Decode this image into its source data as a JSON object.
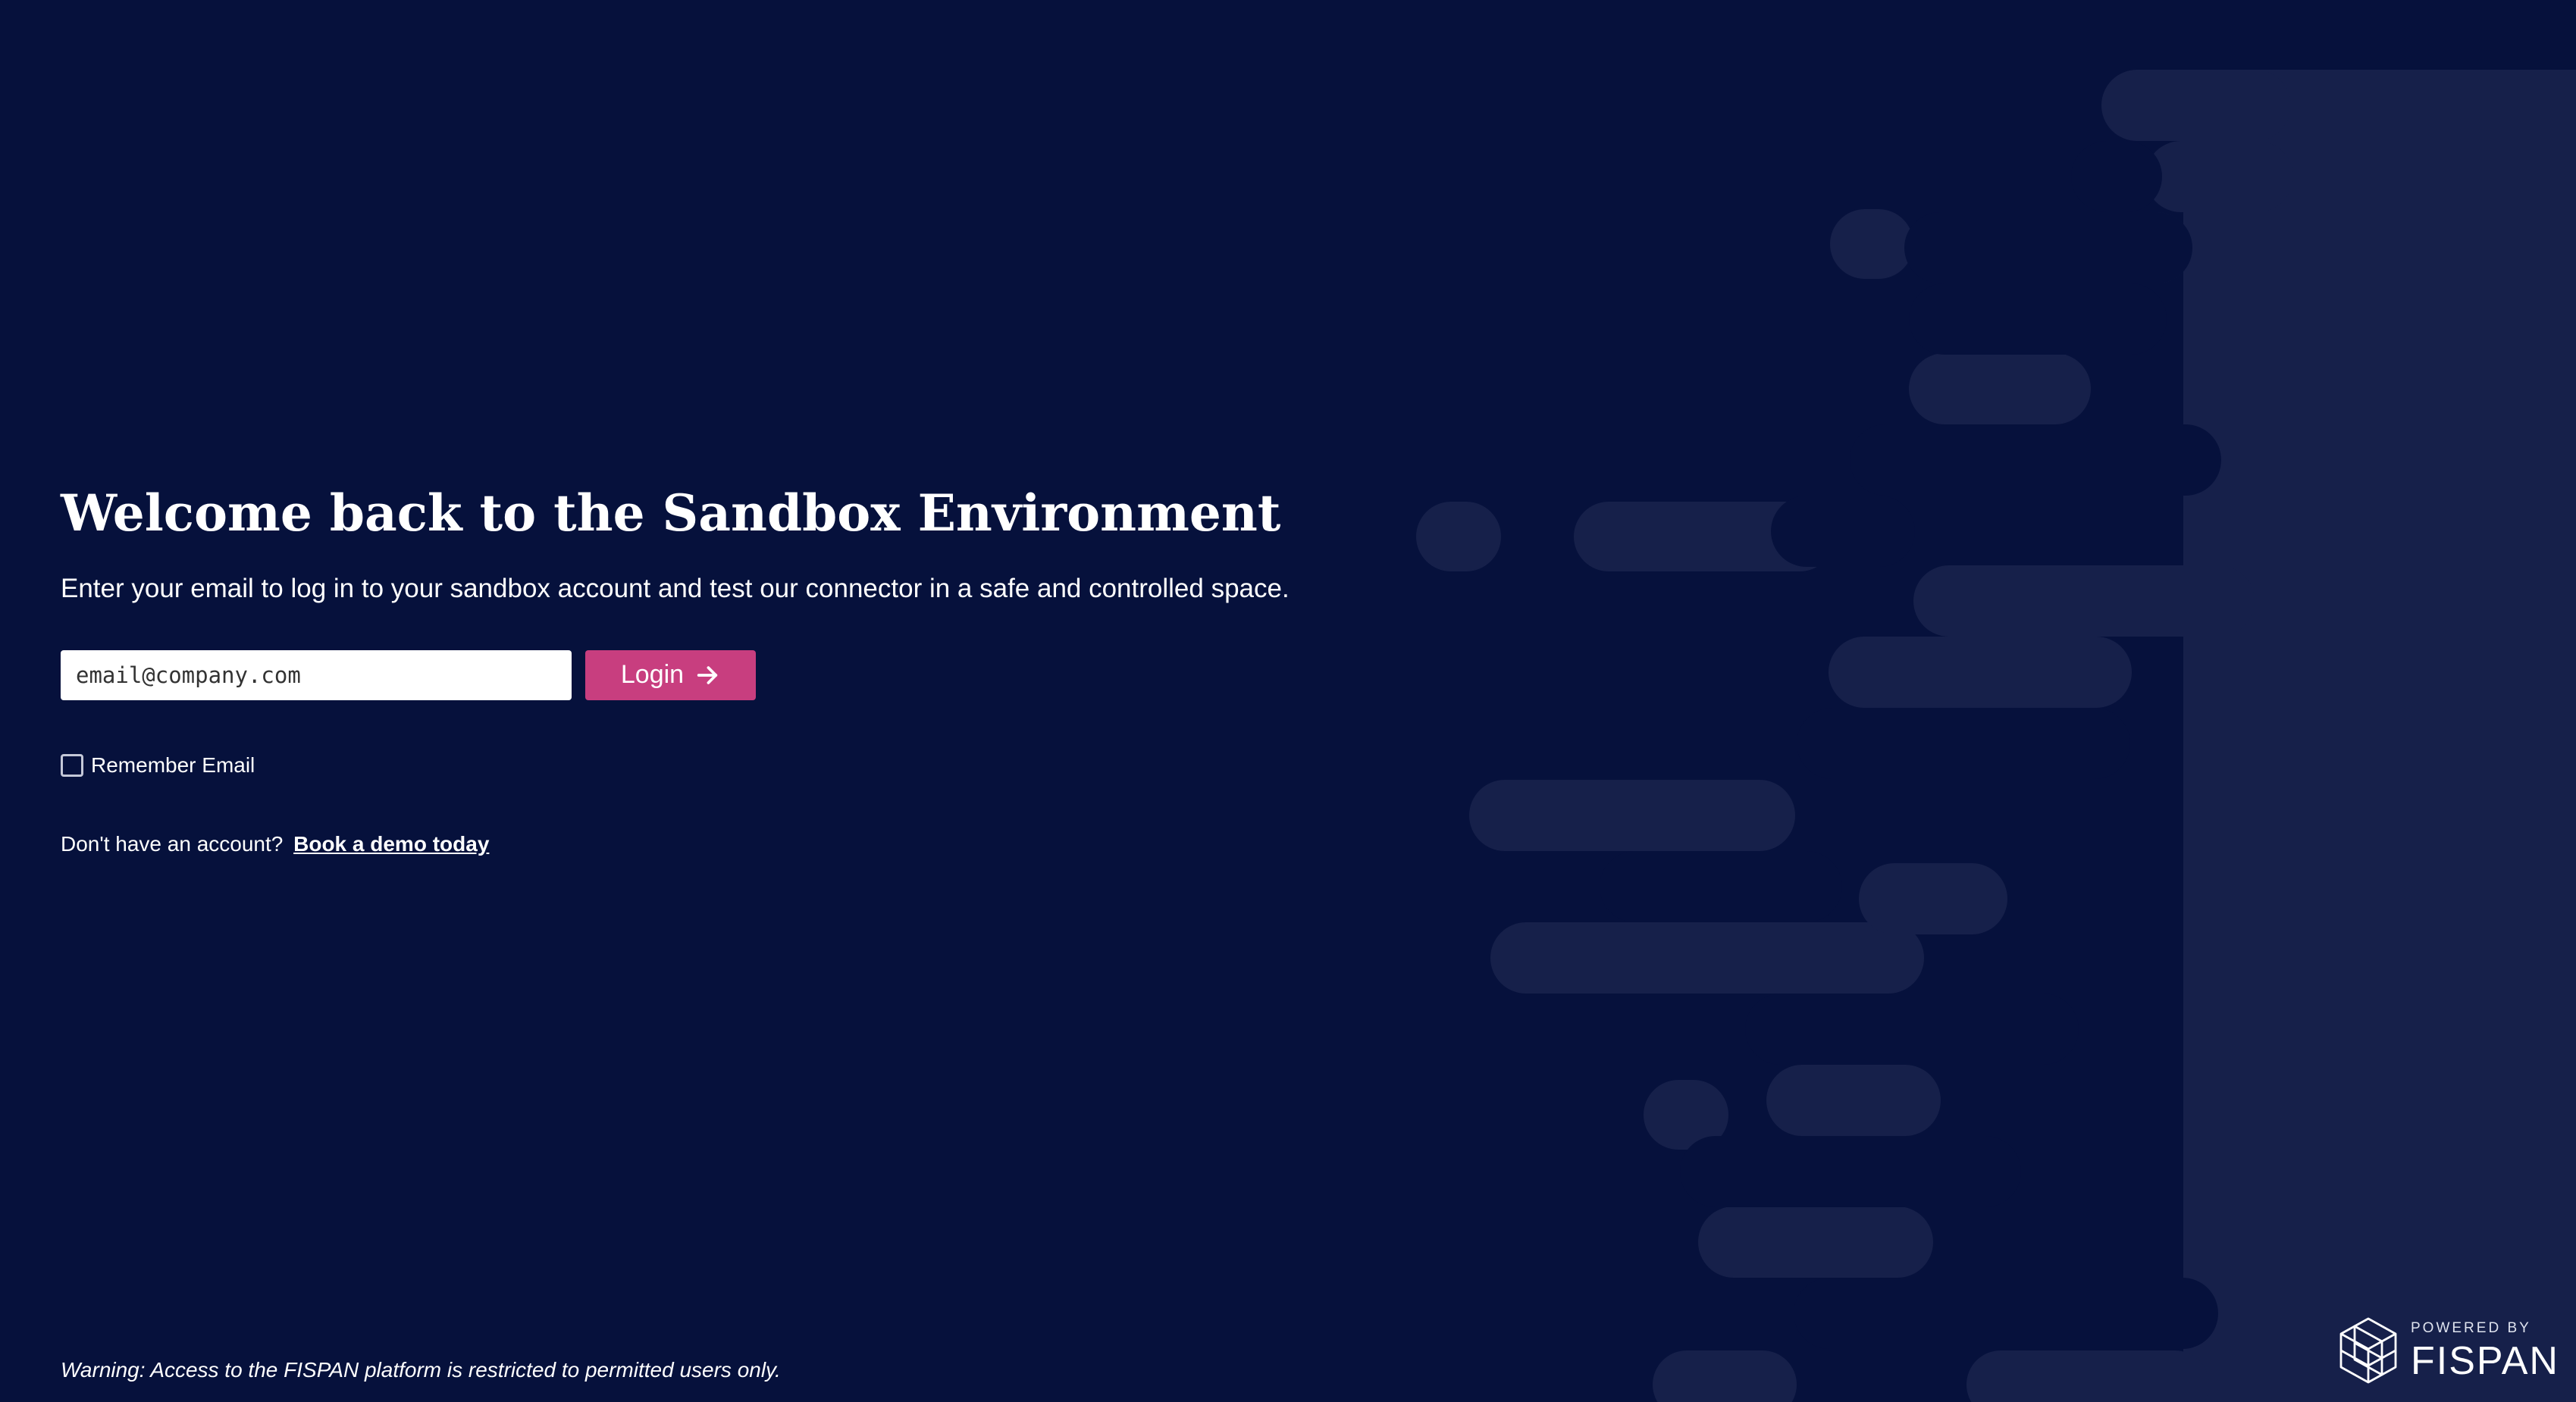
{
  "page": {
    "background_color": "#06113c",
    "pattern_color": "#16204a",
    "accent_color": "#c83e7f"
  },
  "login": {
    "title": "Welcome back to the Sandbox Environment",
    "subtitle": "Enter your email to log in to your sandbox account and test our connector in a safe and controlled space.",
    "email_placeholder": "email@company.com",
    "email_value": "",
    "login_label": "Login",
    "login_icon": "arrow-right-icon",
    "remember_label": "Remember Email",
    "remember_checked": false,
    "signup_prompt": "Don't have an account?",
    "demo_link": "Book a demo today"
  },
  "footer": {
    "warning": "Warning: Access to the FISPAN platform is restricted to permitted users only.",
    "powered_by": "POWERED BY",
    "brand_name": "FISPAN",
    "brand_icon": "fispan-cube-icon"
  }
}
